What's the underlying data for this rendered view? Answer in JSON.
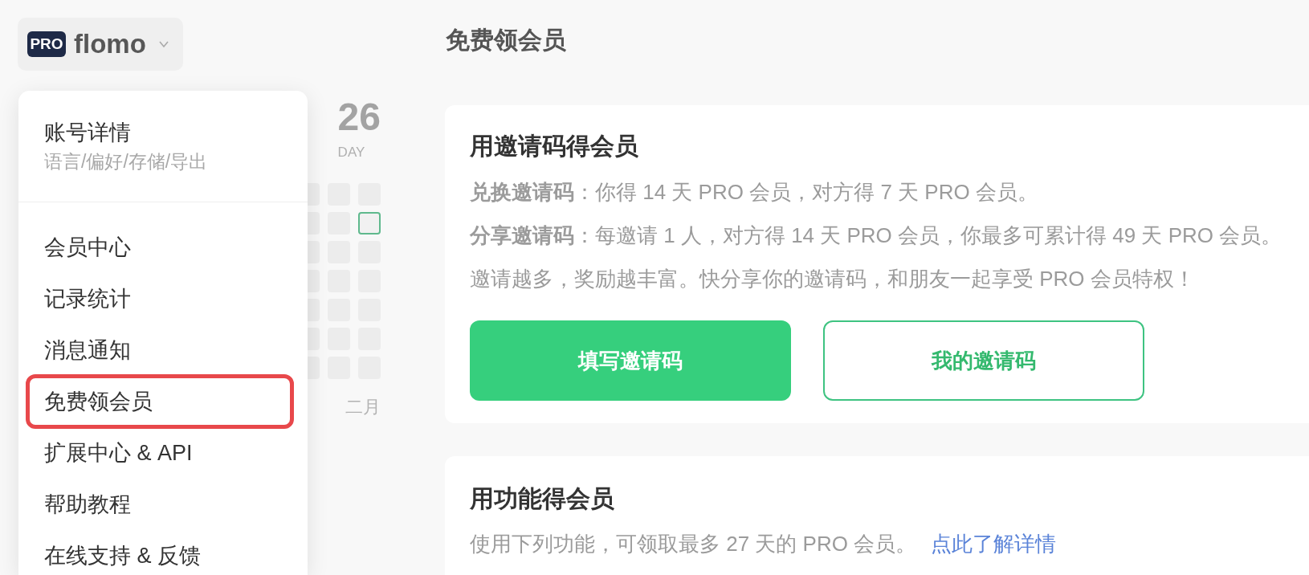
{
  "brand": {
    "badge": "PRO",
    "name": "flomo"
  },
  "account_menu": {
    "header": {
      "title": "账号详情",
      "subtitle": "语言/偏好/存储/导出"
    },
    "items": [
      {
        "label": "会员中心",
        "highlighted": false
      },
      {
        "label": "记录统计",
        "highlighted": false
      },
      {
        "label": "消息通知",
        "highlighted": false
      },
      {
        "label": "免费领会员",
        "highlighted": true
      },
      {
        "label": "扩展中心 & API",
        "highlighted": false
      },
      {
        "label": "帮助教程",
        "highlighted": false
      },
      {
        "label": "在线支持 & 反馈",
        "highlighted": false
      }
    ]
  },
  "heatmap": {
    "count": "26",
    "count_label": "DAY",
    "weeks": [
      {
        "days": [
          {
            "today": false
          },
          {
            "today": false
          },
          {
            "today": false
          },
          {
            "today": false
          },
          {
            "today": false
          },
          {
            "today": false
          },
          {
            "today": false
          }
        ]
      },
      {
        "days": [
          {
            "today": false
          },
          {
            "today": false
          },
          {
            "today": false
          },
          {
            "today": false
          },
          {
            "today": false
          },
          {
            "today": false
          },
          {
            "today": false
          }
        ]
      },
      {
        "days": [
          {
            "today": false
          },
          {
            "today": true
          },
          {
            "today": false
          },
          {
            "today": false
          },
          {
            "today": false
          },
          {
            "today": false
          },
          {
            "today": false
          }
        ]
      }
    ],
    "month": "二月"
  },
  "page": {
    "title": "免费领会员"
  },
  "invite_card": {
    "title": "用邀请码得会员",
    "lines": [
      "**兑换邀请码**：你得 14 天 PRO 会员，对方得 7 天 PRO 会员。",
      "**分享邀请码**：每邀请 1 人，对方得 14 天 PRO 会员，你最多可累计得 49 天 PRO 会员。",
      "邀请越多，奖励越丰富。快分享你的邀请码，和朋友一起享受 PRO 会员特权！"
    ],
    "buttons": [
      {
        "label": "填写邀请码",
        "kind": "primary"
      },
      {
        "label": "我的邀请码",
        "kind": "outline"
      }
    ]
  },
  "feature_card": {
    "title": "用功能得会员",
    "description": "使用下列功能，可领取最多 27 天的 PRO 会员。",
    "link": "点此了解详情"
  }
}
